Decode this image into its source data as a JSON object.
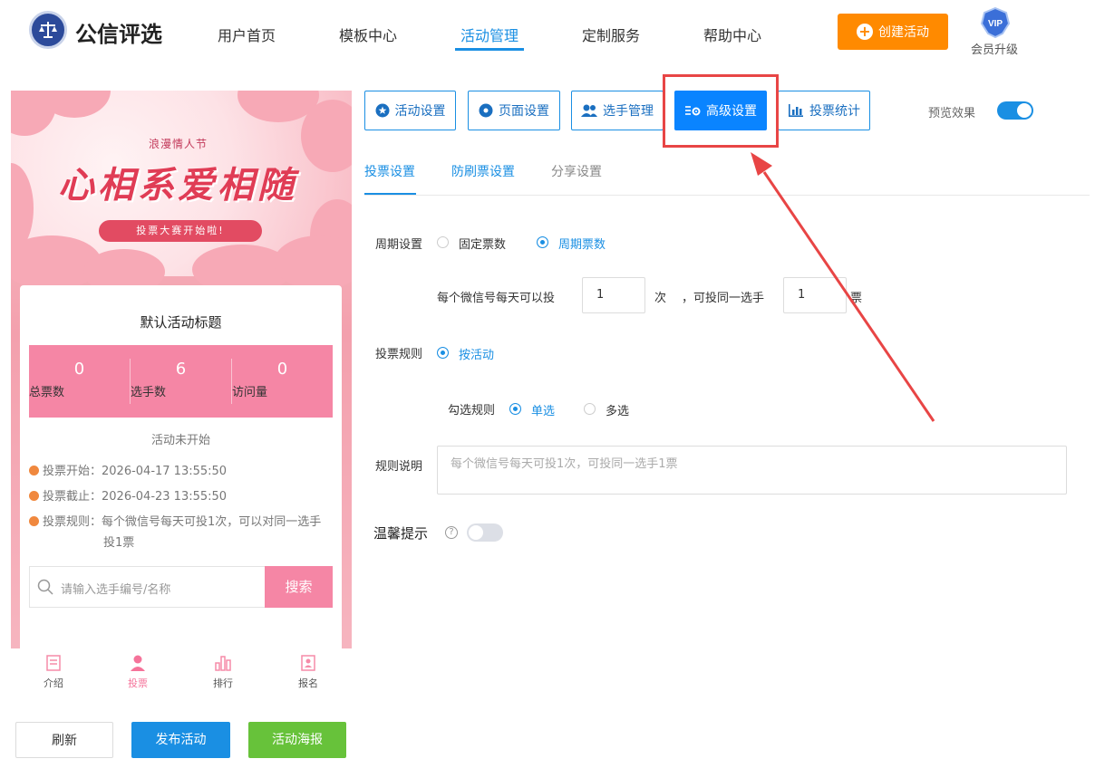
{
  "brand": {
    "name": "公信评选"
  },
  "nav": {
    "items": [
      "用户首页",
      "模板中心",
      "活动管理",
      "定制服务",
      "帮助中心"
    ],
    "active_index": 2,
    "create_label": "创建活动",
    "vip_badge": "VIP",
    "vip_label": "会员升级"
  },
  "preview": {
    "banner_subtitle": "浪漫情人节",
    "banner_title": "心相系爱相随",
    "banner_pill": "投票大赛开始啦!",
    "card_title": "默认活动标题",
    "stats": [
      {
        "value": "0",
        "label": "总票数"
      },
      {
        "value": "6",
        "label": "选手数"
      },
      {
        "value": "0",
        "label": "访问量"
      }
    ],
    "status": "活动未开始",
    "info": [
      "投票开始：2026-04-17 13:55:50",
      "投票截止：2026-04-23 13:55:50",
      "投票规则：每个微信号每天可投1次，可以对同一选手",
      "投1票"
    ],
    "search_placeholder": "请输入选手编号/名称",
    "search_button": "搜索",
    "tabs": [
      "介绍",
      "投票",
      "排行",
      "报名"
    ],
    "active_tab": 1
  },
  "bottom_buttons": {
    "refresh": "刷新",
    "publish": "发布活动",
    "poster": "活动海报"
  },
  "settings_tabs": [
    "活动设置",
    "页面设置",
    "选手管理",
    "高级设置",
    "投票统计"
  ],
  "active_settings_tab": 3,
  "preview_toggle": {
    "label": "预览效果",
    "on": true,
    "color": "#1a8fe3"
  },
  "sub_tabs": [
    "投票设置",
    "防刷票设置",
    "分享设置"
  ],
  "active_sub_tab": 0,
  "form": {
    "cycle_label": "周期设置",
    "cycle_options": [
      "固定票数",
      "周期票数"
    ],
    "cycle_selected": 1,
    "per_day_label": "每个微信号每天可以投",
    "per_day_value": "1",
    "times_unit": "次",
    "same_player_label": "，可投同一选手",
    "same_player_value": "1",
    "votes_unit": "票",
    "rule_label": "投票规则",
    "rule_option": "按活动",
    "check_rule_label": "勾选规则",
    "check_options": [
      "单选",
      "多选"
    ],
    "check_selected": 0,
    "rule_desc_label": "规则说明",
    "rule_desc_placeholder": "每个微信号每天可投1次，可投同一选手1票",
    "tip_label": "温馨提示",
    "tip_help": "?",
    "tip_on": false
  },
  "colors": {
    "primary": "#1a8fe3",
    "orange": "#ff8a00",
    "pink": "#f586a5",
    "green": "#67c23a",
    "annotation": "#e84545"
  }
}
